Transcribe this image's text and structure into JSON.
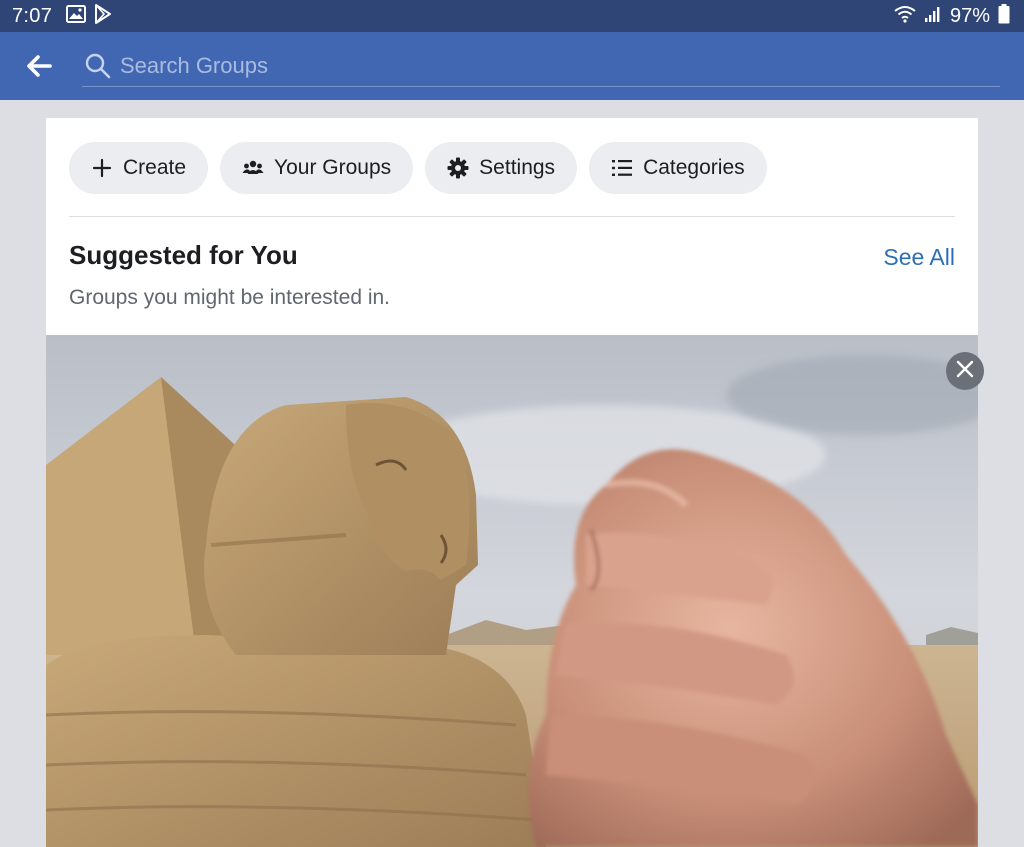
{
  "status_bar": {
    "time": "7:07",
    "battery": "97%",
    "icons": [
      "image-icon",
      "play-store-icon",
      "wifi-icon",
      "signal-icon",
      "battery-icon"
    ]
  },
  "search": {
    "placeholder": "Search Groups",
    "value": ""
  },
  "chips": [
    {
      "label": "Create",
      "icon": "plus-icon"
    },
    {
      "label": "Your Groups",
      "icon": "people-icon"
    },
    {
      "label": "Settings",
      "icon": "gear-icon"
    },
    {
      "label": "Categories",
      "icon": "list-icon"
    }
  ],
  "suggested": {
    "title": "Suggested for You",
    "subtitle": "Groups you might be interested in.",
    "see_all": "See All"
  },
  "colors": {
    "status_bar": "#2f4575",
    "header": "#4267b2",
    "link": "#2d6fb6",
    "chip_bg": "#ebedf0"
  }
}
